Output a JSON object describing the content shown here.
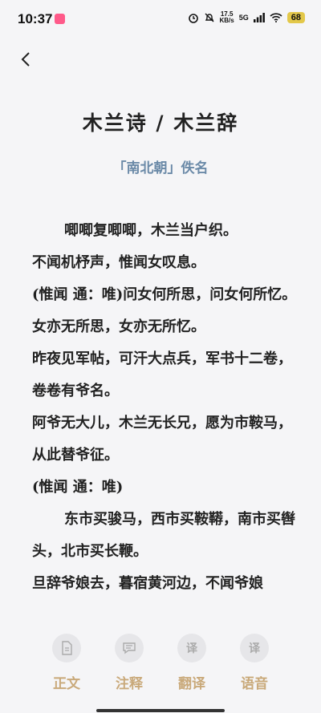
{
  "status": {
    "time": "10:37",
    "net_speed_value": "17.5",
    "net_speed_unit": "KB/s",
    "network": "5G",
    "battery": "68"
  },
  "poem": {
    "title": "木兰诗 / 木兰辞",
    "author": "「南北朝」佚名",
    "lines": [
      "唧唧复唧唧，木兰当户织。",
      "不闻机杼声，惟闻女叹息。",
      "(惟闻 通：唯)问女何所思，问女何所忆。",
      "女亦无所思，女亦无所忆。",
      "昨夜见军帖，可汗大点兵，军书十二卷，卷卷有爷名。",
      "阿爷无大儿，木兰无长兄，愿为市鞍马，从此替爷征。",
      "(惟闻 通：唯)",
      "东市买骏马，西市买鞍鞯，南市买辔头，北市买长鞭。",
      "旦辞爷娘去，暮宿黄河边，不闻爷娘"
    ]
  },
  "tabs": [
    {
      "label": "正文",
      "icon": "document-icon"
    },
    {
      "label": "注释",
      "icon": "comment-icon"
    },
    {
      "label": "翻译",
      "icon": "translate-icon",
      "glyph": "译"
    },
    {
      "label": "语音",
      "icon": "audio-icon",
      "glyph": "译"
    }
  ]
}
